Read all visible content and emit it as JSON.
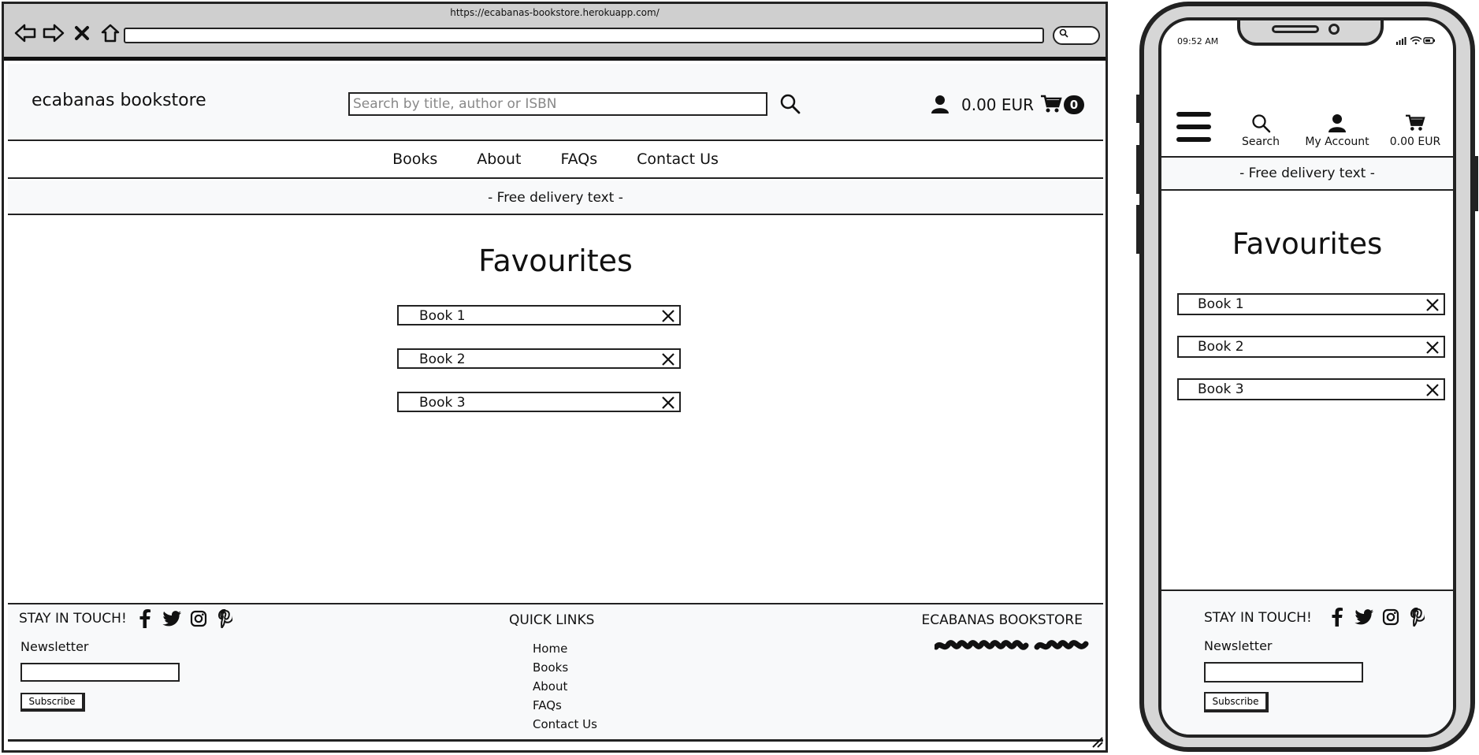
{
  "browser": {
    "url": "https://ecabanas-bookstore.herokuapp.com/",
    "search_pill": "Q"
  },
  "header": {
    "brand": "ecabanas bookstore",
    "search_placeholder": "Search by title, author or ISBN",
    "cart_total": "0.00 EUR",
    "cart_count": "0"
  },
  "nav": {
    "items": [
      "Books",
      "About",
      "FAQs",
      "Contact Us"
    ]
  },
  "banner": {
    "text": "- Free delivery text -"
  },
  "favourites": {
    "title": "Favourites",
    "items": [
      "Book 1",
      "Book 2",
      "Book 3"
    ]
  },
  "footer": {
    "stay_in_touch": "STAY IN TOUCH!",
    "newsletter_label": "Newsletter",
    "subscribe_label": "Subscribe",
    "quick_links_title": "QUICK LINKS",
    "quick_links": [
      "Home",
      "Books",
      "About",
      "FAQs",
      "Contact Us"
    ],
    "store_title": "ECABANAS BOOKSTORE",
    "social_icons": [
      "facebook-icon",
      "twitter-icon",
      "instagram-icon",
      "pinterest-icon"
    ]
  },
  "mobile": {
    "time": "09:52 AM",
    "toolbar": {
      "search_label": "Search",
      "account_label": "My Account",
      "cart_total": "0.00 EUR"
    }
  },
  "colors": {
    "ink": "#111111",
    "panel": "#f8f9fa",
    "chrome": "#cfcfcf"
  }
}
